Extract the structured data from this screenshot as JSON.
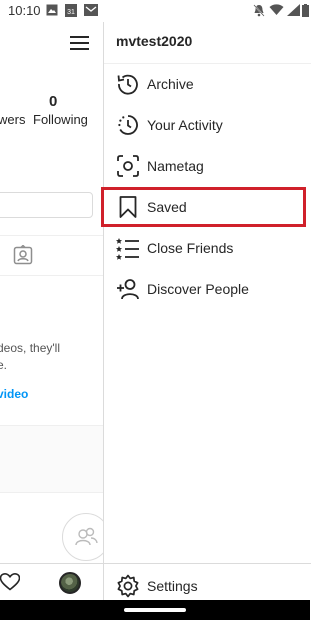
{
  "status": {
    "time": "10:10",
    "calendar_day": "31"
  },
  "profile": {
    "following_count": "0",
    "followers_label": "wers",
    "following_label": "Following",
    "empty_text_line1": "deos, they'll",
    "empty_text_line2": "e.",
    "empty_link": "video"
  },
  "drawer": {
    "username": "mvtest2020",
    "items": [
      {
        "label": "Archive",
        "icon": "archive-icon"
      },
      {
        "label": "Your Activity",
        "icon": "activity-icon"
      },
      {
        "label": "Nametag",
        "icon": "nametag-icon"
      },
      {
        "label": "Saved",
        "icon": "bookmark-icon"
      },
      {
        "label": "Close Friends",
        "icon": "close-friends-icon"
      },
      {
        "label": "Discover People",
        "icon": "add-person-icon"
      }
    ],
    "settings_label": "Settings"
  },
  "colors": {
    "highlight": "#d0202a",
    "link": "#0095f6",
    "text": "#262626"
  }
}
